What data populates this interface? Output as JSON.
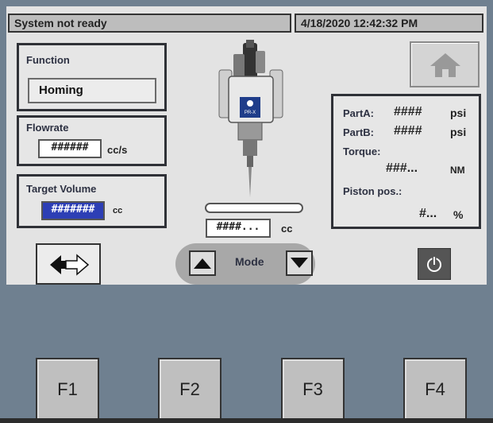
{
  "status": {
    "message": "System not ready",
    "datetime": "4/18/2020 12:42:32 PM"
  },
  "function_box": {
    "label": "Function",
    "value": "Homing"
  },
  "flowrate_box": {
    "label": "Flowrate",
    "value": "######",
    "unit": "cc/s"
  },
  "target_volume_box": {
    "label": "Target Volume",
    "value": "#######",
    "unit": "cc"
  },
  "dispense": {
    "value": "####...",
    "unit": "cc",
    "progress_percent": 0
  },
  "readouts": {
    "partA_label": "PartA:",
    "partA_value": "####",
    "partA_unit": "psi",
    "partB_label": "PartB:",
    "partB_value": "####",
    "partB_unit": "psi",
    "torque_label": "Torque:",
    "torque_value": "###...",
    "torque_unit": "NM",
    "piston_label": "Piston pos.:",
    "piston_value": "#...",
    "piston_unit": "%"
  },
  "mode": {
    "label": "Mode"
  },
  "fkeys": [
    "F1",
    "F2",
    "F3",
    "F4"
  ],
  "icons": {
    "home": "home-icon",
    "nav": "double-arrow-icon",
    "power": "power-icon",
    "mode_up": "triangle-up-icon",
    "mode_down": "triangle-down-icon",
    "dispenser": "dispense-gun-image"
  },
  "device_badge": "PR-X",
  "colors": {
    "panel": "#e3e3e3",
    "background": "#6f8090",
    "selected_field": "#2d3fb5",
    "label_text": "#2d3142"
  }
}
